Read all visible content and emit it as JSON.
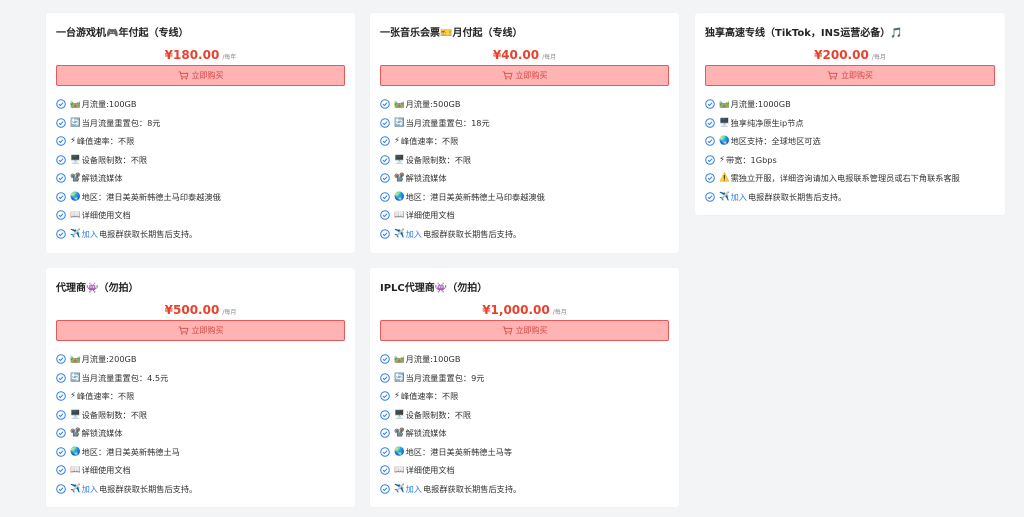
{
  "theme": {
    "price_color": "#e8412d",
    "button_bg": "#ffb3b3",
    "button_border": "#e35a5a",
    "check_color": "#2f7fe6",
    "link_color": "#2f7fe6"
  },
  "cards": [
    {
      "title": "一台游戏机",
      "title_emoji": "🎮",
      "title_suffix": "年付起（专线）",
      "price": "¥180.00",
      "unit": "/每年",
      "button": "立即购买",
      "features": [
        {
          "emoji": "🛤️",
          "text": "月流量:100GB"
        },
        {
          "emoji": "🔄",
          "text": "当月流量重置包：8元"
        },
        {
          "emoji": "⚡",
          "text": "峰值速率：不限"
        },
        {
          "emoji": "🖥️",
          "text": "设备限制数：不限"
        },
        {
          "emoji": "📽️",
          "text": "解锁流媒体"
        },
        {
          "emoji": "🌏",
          "text": "地区：港日美英新韩德土马印泰越澳俄"
        },
        {
          "emoji": "📖",
          "text": "详细使用文档"
        },
        {
          "emoji": "✈️",
          "link": "加入",
          "text": "电报群获取长期售后支持。"
        }
      ]
    },
    {
      "title": "一张音乐会票",
      "title_emoji": "🎫",
      "title_suffix": "月付起（专线）",
      "price": "¥40.00",
      "unit": "/每月",
      "button": "立即购买",
      "features": [
        {
          "emoji": "🛤️",
          "text": "月流量:500GB"
        },
        {
          "emoji": "🔄",
          "text": "当月流量重置包：18元"
        },
        {
          "emoji": "⚡",
          "text": "峰值速率：不限"
        },
        {
          "emoji": "🖥️",
          "text": "设备限制数：不限"
        },
        {
          "emoji": "📽️",
          "text": "解锁流媒体"
        },
        {
          "emoji": "🌏",
          "text": "地区：港日美英新韩德土马印泰越澳俄"
        },
        {
          "emoji": "📖",
          "text": "详细使用文档"
        },
        {
          "emoji": "✈️",
          "link": "加入",
          "text": "电报群获取长期售后支持。"
        }
      ]
    },
    {
      "title": "独享高速专线（TikTok，INS运营必备）",
      "title_emoji": "🎵",
      "title_suffix": "",
      "price": "¥200.00",
      "unit": "/每月",
      "button": "立即购买",
      "features": [
        {
          "emoji": "🛤️",
          "text": "月流量:1000GB"
        },
        {
          "emoji": "🖥️",
          "text": "独享纯净原生ip节点"
        },
        {
          "emoji": "🌏",
          "text": "地区支持：全球地区可选"
        },
        {
          "emoji": "⚡",
          "text": "带宽：1Gbps"
        },
        {
          "emoji": "⚠️",
          "text": "需独立开服，详细咨询请加入电报联系管理员或右下角联系客服"
        },
        {
          "emoji": "✈️",
          "link": "加入",
          "text": "电报群获取长期售后支持。"
        }
      ]
    },
    {
      "title": "代理商",
      "title_emoji": "👾",
      "title_suffix": "（勿拍）",
      "price": "¥500.00",
      "unit": "/每月",
      "button": "立即购买",
      "features": [
        {
          "emoji": "🛤️",
          "text": "月流量:200GB"
        },
        {
          "emoji": "🔄",
          "text": "当月流量重置包：4.5元"
        },
        {
          "emoji": "⚡",
          "text": "峰值速率：不限"
        },
        {
          "emoji": "🖥️",
          "text": "设备限制数：不限"
        },
        {
          "emoji": "📽️",
          "text": "解锁流媒体"
        },
        {
          "emoji": "🌏",
          "text": "地区：港日美英新韩德土马"
        },
        {
          "emoji": "📖",
          "text": "详细使用文档"
        },
        {
          "emoji": "✈️",
          "link": "加入",
          "text": "电报群获取长期售后支持。"
        }
      ]
    },
    {
      "title": "IPLC代理商",
      "title_emoji": "👾",
      "title_suffix": "（勿拍）",
      "price": "¥1,000.00",
      "unit": "/每月",
      "button": "立即购买",
      "features": [
        {
          "emoji": "🛤️",
          "text": "月流量:100GB"
        },
        {
          "emoji": "🔄",
          "text": "当月流量重置包：9元"
        },
        {
          "emoji": "⚡",
          "text": "峰值速率：不限"
        },
        {
          "emoji": "🖥️",
          "text": "设备限制数：不限"
        },
        {
          "emoji": "📽️",
          "text": "解锁流媒体"
        },
        {
          "emoji": "🌏",
          "text": "地区：港日美英新韩德土马等"
        },
        {
          "emoji": "📖",
          "text": "详细使用文档"
        },
        {
          "emoji": "✈️",
          "link": "加入",
          "text": "电报群获取长期售后支持。"
        }
      ]
    }
  ]
}
